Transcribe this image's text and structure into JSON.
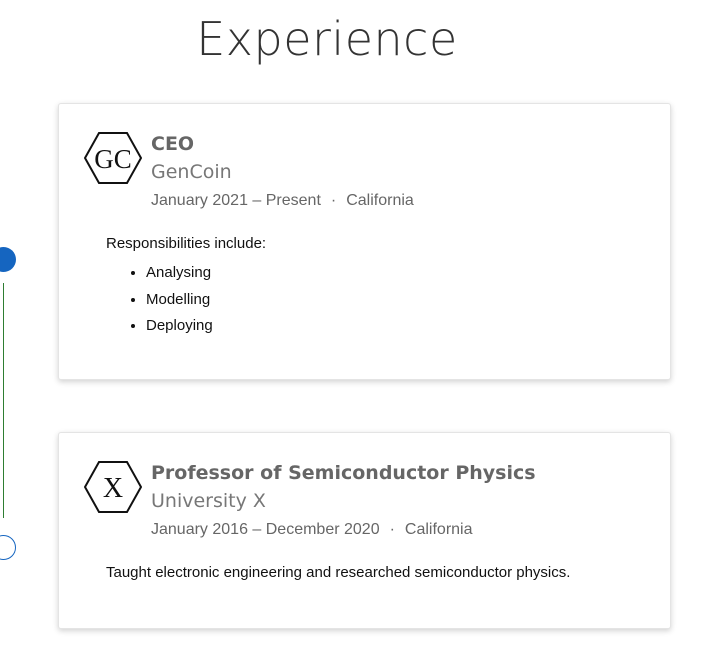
{
  "section": {
    "title": "Experience"
  },
  "experiences": [
    {
      "logo_text": "GC",
      "role": "CEO",
      "organization": "GenCoin",
      "dates": "January 2021 – Present",
      "separator": "·",
      "location": "California",
      "description": "Responsibilities include:",
      "bullets": [
        "Analysing",
        "Modelling",
        "Deploying"
      ]
    },
    {
      "logo_text": "X",
      "role": "Professor of Semiconductor Physics",
      "organization": "University X",
      "dates": "January 2016 – December 2020",
      "separator": "·",
      "location": "California",
      "description": "Taught electronic engineering and researched semiconductor physics."
    }
  ],
  "colors": {
    "timeline_dot": "#1565c0",
    "timeline_line": "#2e7d32"
  }
}
